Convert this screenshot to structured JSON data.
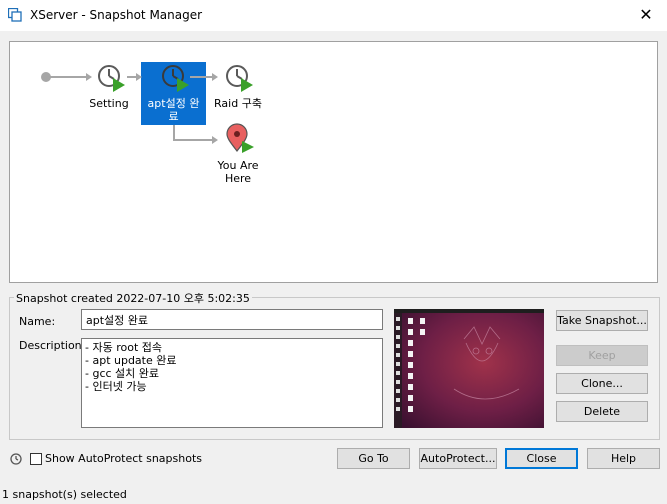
{
  "window": {
    "title": "XServer - Snapshot Manager",
    "close_glyph": "✕"
  },
  "tree": {
    "nodes": [
      {
        "label": "Setting",
        "icon": "snapshot-clock-icon"
      },
      {
        "label_line1": "apt설정 완",
        "label_line2": "료",
        "icon": "snapshot-clock-icon",
        "selected": true
      },
      {
        "label": "Raid 구축",
        "icon": "snapshot-clock-icon"
      },
      {
        "label_line1": "You Are",
        "label_line2": "Here",
        "icon": "location-pin-icon"
      }
    ]
  },
  "details": {
    "created": "Snapshot created 2022-07-10 오후 5:02:35",
    "name_label": "Name:",
    "name_value": "apt설정 완료",
    "description_label": "Description:",
    "description_lines": [
      "- 자동 root 접속",
      "- apt update 완료",
      "- gcc 설치 완료",
      "- 인터넷 가능"
    ]
  },
  "actions": {
    "take_snapshot": "Take Snapshot...",
    "keep": "Keep",
    "clone": "Clone...",
    "delete": "Delete"
  },
  "footer": {
    "show_autoprotect": "Show AutoProtect snapshots",
    "go_to": "Go To",
    "autoprotect": "AutoProtect...",
    "close": "Close",
    "help": "Help"
  },
  "status": {
    "text": "1 snapshot(s) selected"
  },
  "colors": {
    "selected_bg": "#0a6fd0",
    "arrow_green": "#3aa02a",
    "pin": "#e86060"
  }
}
